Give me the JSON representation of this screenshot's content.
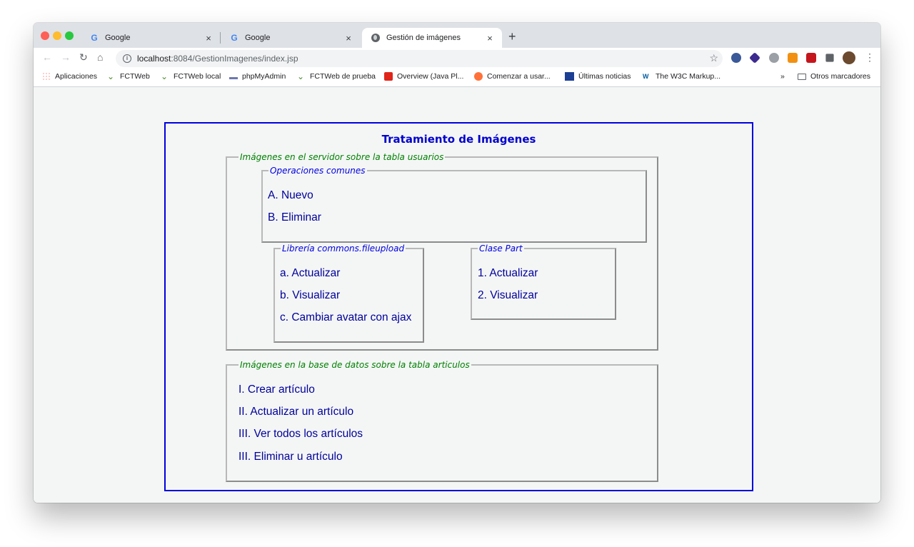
{
  "browser": {
    "tabs": [
      {
        "title": "Google",
        "icon": "google-icon"
      },
      {
        "title": "Google",
        "icon": "google-icon"
      },
      {
        "title": "Gestión de imágenes",
        "icon": "globe-icon",
        "active": true
      }
    ],
    "new_tab": "+",
    "close_symbol": "×",
    "url_host": "localhost",
    "url_rest": ":8084/GestionImagenes/index.jsp"
  },
  "bookmarks": {
    "items": [
      {
        "label": "Aplicaciones",
        "icon": "apps-grid-icon"
      },
      {
        "label": "FCTWeb",
        "icon": "sprout-icon"
      },
      {
        "label": "FCTWeb local",
        "icon": "sprout-icon"
      },
      {
        "label": "phpMyAdmin",
        "icon": "phpmyadmin-icon"
      },
      {
        "label": "FCTWeb de prueba",
        "icon": "sprout-icon"
      },
      {
        "label": "Overview (Java Pl...",
        "icon": "oracle-icon"
      },
      {
        "label": "Comenzar a usar...",
        "icon": "firefox-icon"
      },
      {
        "label": "Últimas noticias",
        "icon": "news-20-icon"
      },
      {
        "label": "The W3C Markup...",
        "icon": "w3c-icon"
      }
    ],
    "more": "»",
    "other": "Otros marcadores"
  },
  "page": {
    "title": "Tratamiento de Imágenes",
    "servidor": {
      "legend": "Imágenes en el servidor sobre la tabla usuarios",
      "comunes": {
        "legend": "Operaciones comunes",
        "links": [
          "A. Nuevo",
          "B. Eliminar"
        ]
      },
      "fileupload": {
        "legend": "Librería commons.fileupload",
        "links": [
          "a. Actualizar",
          "b. Visualizar",
          "c. Cambiar avatar con ajax"
        ]
      },
      "part": {
        "legend": "Clase Part",
        "links": [
          "1. Actualizar",
          "2. Visualizar"
        ]
      }
    },
    "bd": {
      "legend": "Imágenes en la base de datos sobre la tabla articulos",
      "links": [
        "I. Crear artículo",
        "II. Actualizar un artículo",
        "III. Ver todos los artículos",
        "III. Eliminar u artículo"
      ]
    }
  }
}
